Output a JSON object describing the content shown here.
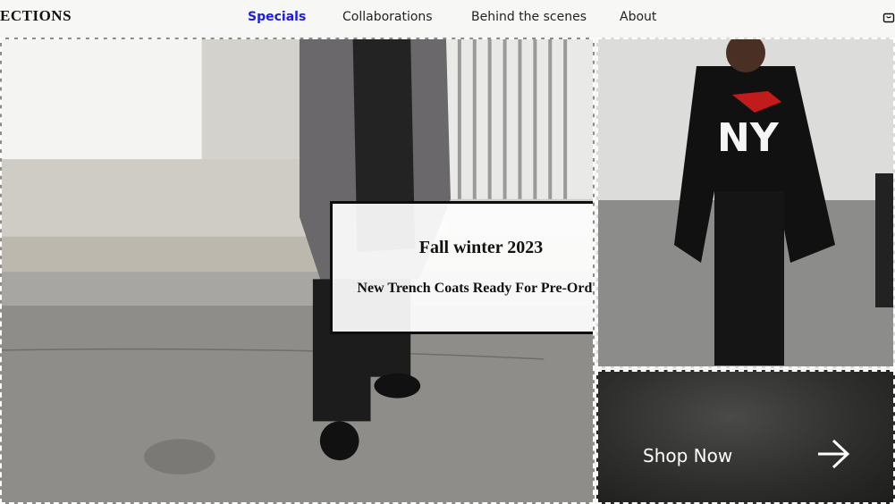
{
  "header": {
    "brand": "ECTIONS",
    "nav": [
      {
        "label": "Specials",
        "active": true
      },
      {
        "label": "Collaborations",
        "active": false
      },
      {
        "label": "Behind the scenes",
        "active": false
      },
      {
        "label": "About",
        "active": false
      }
    ],
    "icons": {
      "cart": "shopping-bag-icon"
    }
  },
  "hero": {
    "promo_title": "Fall winter 2023",
    "promo_subtitle": "New Trench Coats Ready For Pre-Order"
  },
  "shop": {
    "label": "Shop Now",
    "icon": "arrow-right-icon"
  },
  "colors": {
    "accent": "#1d1de0",
    "text": "#111111",
    "card_border": "#0d0d0d"
  }
}
